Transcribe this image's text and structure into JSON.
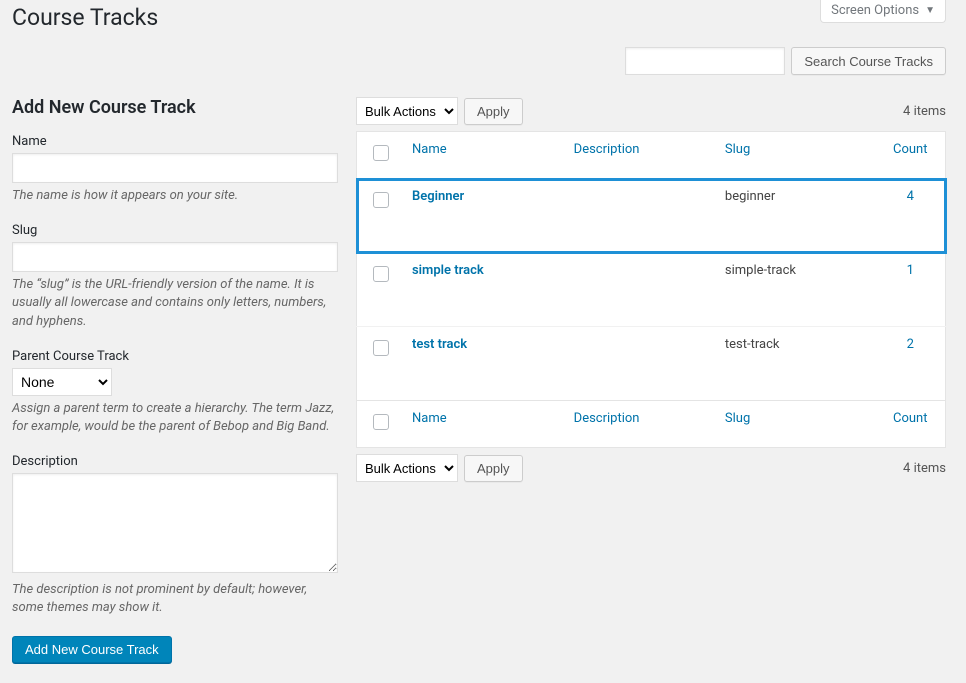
{
  "header": {
    "title": "Course Tracks",
    "screen_options": "Screen Options"
  },
  "search": {
    "button": "Search Course Tracks"
  },
  "form": {
    "heading": "Add New Course Track",
    "name_label": "Name",
    "name_help": "The name is how it appears on your site.",
    "slug_label": "Slug",
    "slug_help": "The “slug” is the URL-friendly version of the name. It is usually all lowercase and contains only letters, numbers, and hyphens.",
    "parent_label": "Parent Course Track",
    "parent_selected": "None",
    "parent_help": "Assign a parent term to create a hierarchy. The term Jazz, for example, would be the parent of Bebop and Big Band.",
    "description_label": "Description",
    "description_help": "The description is not prominent by default; however, some themes may show it.",
    "submit": "Add New Course Track"
  },
  "table": {
    "bulk_label": "Bulk Actions",
    "apply": "Apply",
    "items_count": "4 items",
    "columns": {
      "name": "Name",
      "description": "Description",
      "slug": "Slug",
      "count": "Count"
    },
    "rows": [
      {
        "name": "Beginner",
        "description": "",
        "slug": "beginner",
        "count": "4",
        "highlight": true
      },
      {
        "name": "simple track",
        "description": "",
        "slug": "simple-track",
        "count": "1",
        "highlight": false
      },
      {
        "name": "test track",
        "description": "",
        "slug": "test-track",
        "count": "2",
        "highlight": false
      }
    ]
  }
}
